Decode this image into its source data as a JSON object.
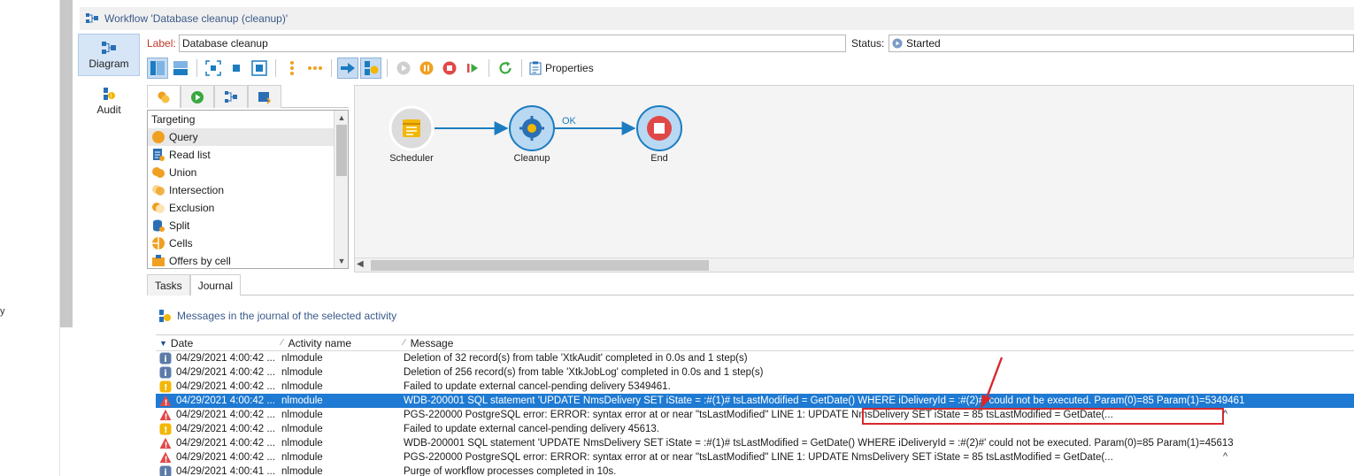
{
  "app": {
    "window_title": "Workflow 'Database cleanup (cleanup)'",
    "left_fragment": "y"
  },
  "vnav": {
    "items": [
      {
        "label": "Diagram",
        "icon": "diagram-icon"
      },
      {
        "label": "Audit",
        "icon": "audit-icon"
      }
    ]
  },
  "form": {
    "label_caption": "Label:",
    "label_value": "Database cleanup",
    "status_caption": "Status:",
    "status_value": "Started"
  },
  "toolbar": {
    "properties_label": "Properties"
  },
  "palette": {
    "category": "Targeting",
    "items": [
      {
        "label": "Query",
        "icon": "query-icon"
      },
      {
        "label": "Read list",
        "icon": "read-list-icon"
      },
      {
        "label": "Union",
        "icon": "union-icon"
      },
      {
        "label": "Intersection",
        "icon": "intersection-icon"
      },
      {
        "label": "Exclusion",
        "icon": "exclusion-icon"
      },
      {
        "label": "Split",
        "icon": "split-icon"
      },
      {
        "label": "Cells",
        "icon": "cells-icon"
      },
      {
        "label": "Offers by cell",
        "icon": "offers-icon"
      }
    ]
  },
  "diagram": {
    "nodes": [
      {
        "label": "Scheduler",
        "icon": "calendar-icon"
      },
      {
        "label": "Cleanup",
        "icon": "gear-icon"
      },
      {
        "label": "End",
        "icon": "stop-icon"
      }
    ],
    "transition_label": "OK",
    "colors": {
      "arrow": "#1c7cc0",
      "node_fill": "#b9d8f2",
      "stop": "#e04848"
    }
  },
  "bottom_tabs": [
    "Tasks",
    "Journal"
  ],
  "journal": {
    "heading": "Messages in the journal of the selected activity",
    "columns": {
      "date": "Date",
      "activity": "Activity name",
      "message": "Message"
    },
    "rows": [
      {
        "type": "info",
        "date": "04/29/2021 4:00:42 ...",
        "activity": "nlmodule",
        "message": "Deletion of 32 record(s) from table 'XtkAudit' completed in 0.0s and 1 step(s)"
      },
      {
        "type": "info",
        "date": "04/29/2021 4:00:42 ...",
        "activity": "nlmodule",
        "message": "Deletion of 256 record(s) from table 'XtkJobLog' completed in 0.0s and 1 step(s)"
      },
      {
        "type": "warning",
        "date": "04/29/2021 4:00:42 ...",
        "activity": "nlmodule",
        "message": "Failed to update external cancel-pending delivery 5349461."
      },
      {
        "type": "error",
        "date": "04/29/2021 4:00:42 ...",
        "activity": "nlmodule",
        "message": "WDB-200001 SQL statement 'UPDATE NmsDelivery SET iState = :#(1)# tsLastModified = GetDate() WHERE iDeliveryId = :#(2)#' could not be executed.   Param(0)=85   Param(1)=5349461",
        "selected": true
      },
      {
        "type": "error",
        "date": "04/29/2021 4:00:42 ...",
        "activity": "nlmodule",
        "message": "PGS-220000 PostgreSQL error: ERROR:  syntax error at or near \"tsLastModified\" LINE 1: UPDATE NmsDelivery SET iState = 85 tsLastModified = GetDate(..."
      },
      {
        "type": "warning",
        "date": "04/29/2021 4:00:42 ...",
        "activity": "nlmodule",
        "message": "Failed to update external cancel-pending delivery 45613."
      },
      {
        "type": "error",
        "date": "04/29/2021 4:00:42 ...",
        "activity": "nlmodule",
        "message": "WDB-200001 SQL statement 'UPDATE NmsDelivery SET iState = :#(1)# tsLastModified = GetDate() WHERE iDeliveryId = :#(2)#' could not be executed.   Param(0)=85   Param(1)=45613"
      },
      {
        "type": "error",
        "date": "04/29/2021 4:00:42 ...",
        "activity": "nlmodule",
        "message": "PGS-220000 PostgreSQL error: ERROR:  syntax error at or near \"tsLastModified\" LINE 1: UPDATE NmsDelivery SET iState = 85 tsLastModified = GetDate(..."
      },
      {
        "type": "info",
        "date": "04/29/2021 4:00:41 ...",
        "activity": "nlmodule",
        "message": "Purge of workflow processes completed in 10s."
      }
    ],
    "caret": "^",
    "colors": {
      "selected_row": "#1e7ad2",
      "annotation": "#d8282c"
    }
  }
}
